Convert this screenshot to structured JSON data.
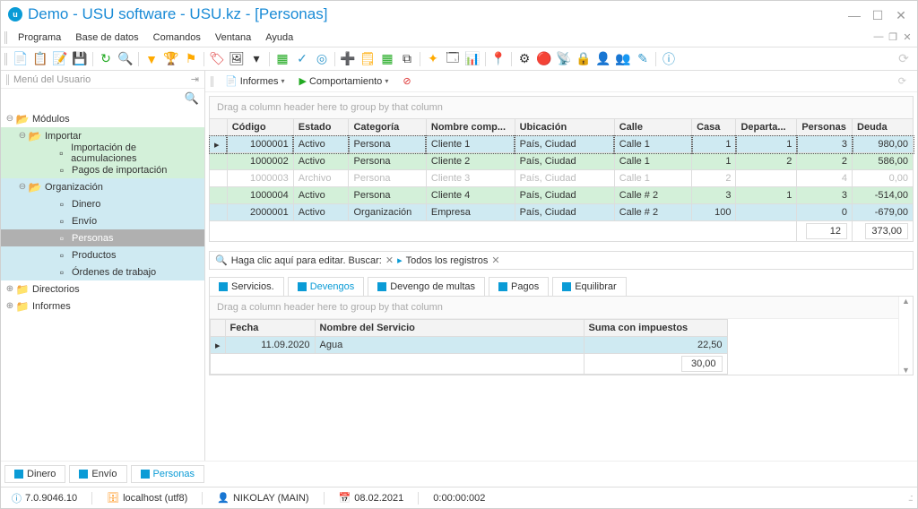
{
  "title": "Demo - USU software - USU.kz - [Personas]",
  "menu": [
    "Programa",
    "Base de datos",
    "Comandos",
    "Ventana",
    "Ayuda"
  ],
  "sidebar": {
    "title": "Menú del Usuario",
    "items": [
      {
        "label": "Módulos",
        "level": 0,
        "open": true,
        "icon": "📂"
      },
      {
        "label": "Importar",
        "level": 1,
        "open": true,
        "icon": "📂",
        "cls": ""
      },
      {
        "label": "Importación de acumulaciones",
        "level": 2,
        "icon": "▫",
        "cls": ""
      },
      {
        "label": "Pagos de importación",
        "level": 2,
        "icon": "▫",
        "cls": ""
      },
      {
        "label": "Organización",
        "level": 1,
        "open": true,
        "icon": "📂",
        "cls": "org"
      },
      {
        "label": "Dinero",
        "level": 2,
        "icon": "▫",
        "cls": "org"
      },
      {
        "label": "Envío",
        "level": 2,
        "icon": "▫",
        "cls": "org"
      },
      {
        "label": "Personas",
        "level": 2,
        "icon": "▫",
        "cls": "org",
        "selected": true
      },
      {
        "label": "Productos",
        "level": 2,
        "icon": "▫",
        "cls": "org"
      },
      {
        "label": "Órdenes de trabajo",
        "level": 2,
        "icon": "▫",
        "cls": "org"
      },
      {
        "label": "Directorios",
        "level": 0,
        "open": false,
        "icon": "📁"
      },
      {
        "label": "Informes",
        "level": 0,
        "open": false,
        "icon": "📁"
      }
    ]
  },
  "subtoolbar": {
    "reports": "Informes",
    "behavior": "Comportamiento"
  },
  "grid": {
    "groupHint": "Drag a column header here to group by that column",
    "columns": [
      "Código",
      "Estado",
      "Categoría",
      "Nombre comp...",
      "Ubicación",
      "Calle",
      "Casa",
      "Departa...",
      "Personas",
      "Deuda"
    ],
    "widths": [
      60,
      50,
      70,
      80,
      90,
      70,
      40,
      55,
      50,
      55
    ],
    "rows": [
      {
        "cls": "blue selrow",
        "cells": [
          "1000001",
          "Activo",
          "Persona",
          "Cliente 1",
          "País, Ciudad",
          "Calle 1",
          "1",
          "1",
          "3",
          "980,00"
        ]
      },
      {
        "cls": "green",
        "cells": [
          "1000002",
          "Activo",
          "Persona",
          "Cliente 2",
          "País, Ciudad",
          "Calle 1",
          "1",
          "2",
          "2",
          "586,00"
        ]
      },
      {
        "cls": "grey",
        "cells": [
          "1000003",
          "Archivo",
          "Persona",
          "Cliente 3",
          "País, Ciudad",
          "Calle 1",
          "2",
          "",
          "4",
          "0,00"
        ]
      },
      {
        "cls": "green",
        "cells": [
          "1000004",
          "Activo",
          "Persona",
          "Cliente 4",
          "País, Ciudad",
          "Calle # 2",
          "3",
          "1",
          "3",
          "-514,00"
        ]
      },
      {
        "cls": "blue",
        "cells": [
          "2000001",
          "Activo",
          "Organización",
          "Empresa",
          "País, Ciudad",
          "Calle # 2",
          "100",
          "",
          "0",
          "-679,00"
        ]
      }
    ],
    "footer": {
      "persons": "12",
      "debt": "373,00"
    }
  },
  "filter": {
    "edit": "Haga clic aquí para editar. Buscar:",
    "all": "Todos los registros"
  },
  "detailTabs": [
    "Servicios.",
    "Devengos",
    "Devengo de multas",
    "Pagos",
    "Equilibrar"
  ],
  "detailActive": 1,
  "subgrid": {
    "groupHint": "Drag a column header here to group by that column",
    "columns": [
      "Fecha",
      "Nombre del Servicio",
      "Suma con impuestos"
    ],
    "widths": [
      100,
      300,
      160
    ],
    "rows": [
      {
        "cls": "blue",
        "cells": [
          "11.09.2020",
          "Agua",
          "22,50"
        ]
      }
    ],
    "footer": "30,00"
  },
  "bottomTabs": [
    "Dinero",
    "Envío",
    "Personas"
  ],
  "bottomActive": 2,
  "status": {
    "version": "7.0.9046.10",
    "host": "localhost (utf8)",
    "user": "NIKOLAY (MAIN)",
    "date": "08.02.2021",
    "time": "0:00:00:002"
  }
}
